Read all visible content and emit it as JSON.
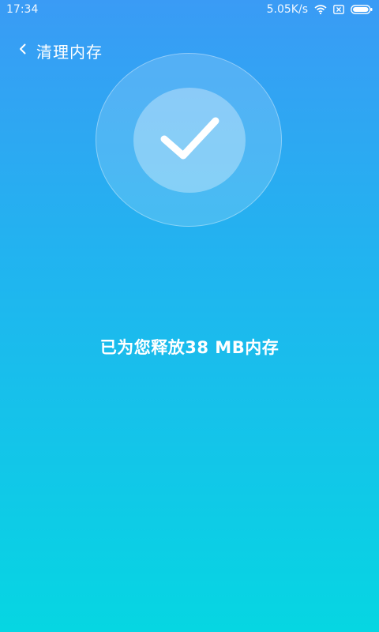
{
  "status_bar": {
    "time": "17:34",
    "network_speed": "5.05K/s",
    "icons": [
      "wifi-icon",
      "sim-blocked-icon",
      "battery-icon"
    ]
  },
  "header": {
    "back_icon": "chevron-left-icon",
    "title": "清理内存"
  },
  "result": {
    "icon": "checkmark-icon",
    "message": "已为您释放38 MB内存"
  },
  "colors": {
    "gradient_top": "#3a9bf5",
    "gradient_mid": "#1fb6ef",
    "gradient_bottom": "#06d6e2",
    "text": "#ffffff"
  }
}
